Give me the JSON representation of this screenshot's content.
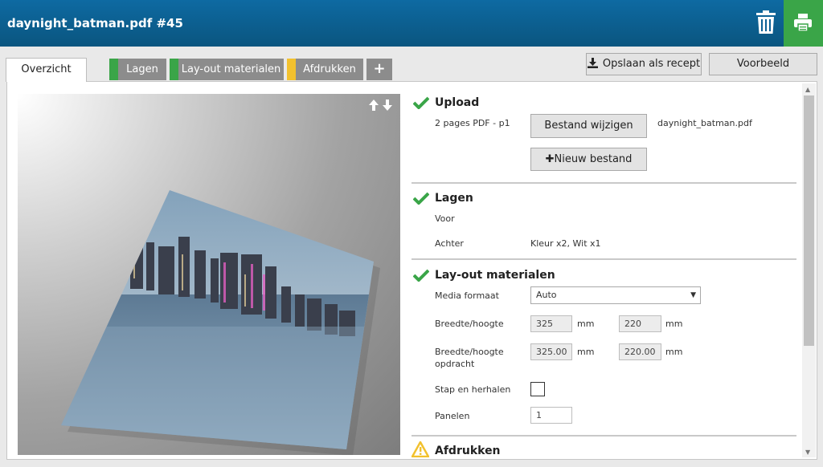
{
  "header": {
    "title": "daynight_batman.pdf #45"
  },
  "tabs": [
    {
      "label": "Overzicht"
    },
    {
      "label": "Lagen",
      "color": "#3aa548"
    },
    {
      "label": "Lay-out materialen",
      "color": "#3aa548"
    },
    {
      "label": "Afdrukken",
      "color": "#f2c12e"
    },
    {
      "label": "+"
    }
  ],
  "toolbar": {
    "save_recipe": "Opslaan als recept",
    "preview": "Voorbeeld"
  },
  "upload": {
    "title": "Upload",
    "info": "2 pages PDF - p1",
    "change_file": "Bestand wijzigen",
    "filename": "daynight_batman.pdf",
    "new_file": "Nieuw bestand"
  },
  "layers": {
    "title": "Lagen",
    "front": "Voor",
    "back": "Achter",
    "back_value": "Kleur x2, Wit x1"
  },
  "layout": {
    "title": "Lay-out materialen",
    "media_label": "Media formaat",
    "media_value": "Auto",
    "size_label": "Breedte/hoogte",
    "width": "325",
    "height": "220",
    "unit": "mm",
    "order_size_label_1": "Breedte/hoogte",
    "order_size_label_2": "opdracht",
    "order_width": "325.00",
    "order_height": "220.00",
    "step_repeat_label": "Stap en herhalen",
    "panels_label": "Panelen",
    "panels_value": "1"
  },
  "print": {
    "title": "Afdrukken"
  },
  "colors": {
    "header": "#0a5f8f",
    "accent_green": "#3aa548",
    "warning": "#f2c12e"
  }
}
